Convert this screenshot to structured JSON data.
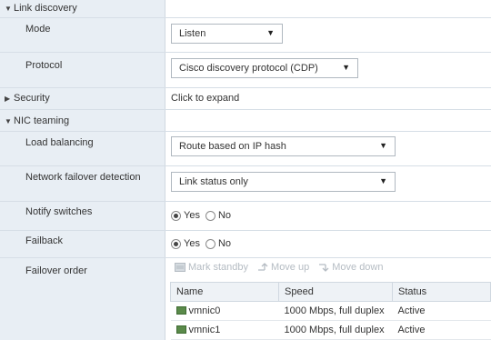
{
  "link_discovery": {
    "header": "Link discovery",
    "mode_label": "Mode",
    "mode_value": "Listen",
    "protocol_label": "Protocol",
    "protocol_value": "Cisco discovery protocol (CDP)"
  },
  "security": {
    "header": "Security",
    "value": "Click to expand"
  },
  "nic_teaming": {
    "header": "NIC teaming",
    "load_balancing_label": "Load balancing",
    "load_balancing_value": "Route based on IP hash",
    "failover_detection_label": "Network failover detection",
    "failover_detection_value": "Link status only",
    "notify_switches_label": "Notify switches",
    "notify_switches": {
      "yes": "Yes",
      "no": "No",
      "selected": "yes"
    },
    "failback_label": "Failback",
    "failback": {
      "yes": "Yes",
      "no": "No",
      "selected": "yes"
    },
    "failover_order_label": "Failover order",
    "toolbar": {
      "mark_standby": "Mark standby",
      "move_up": "Move up",
      "move_down": "Move down"
    },
    "table": {
      "columns": [
        "Name",
        "Speed",
        "Status"
      ],
      "rows": [
        {
          "name": "vmnic0",
          "speed": "1000 Mbps, full duplex",
          "status": "Active"
        },
        {
          "name": "vmnic1",
          "speed": "1000 Mbps, full duplex",
          "status": "Active"
        }
      ]
    }
  },
  "colors": {
    "label_column_bg": "#e8eef4",
    "row_border": "#d6dee6",
    "toolbar_disabled": "#b5bcc3",
    "nic_icon": "#5a8a4a"
  }
}
